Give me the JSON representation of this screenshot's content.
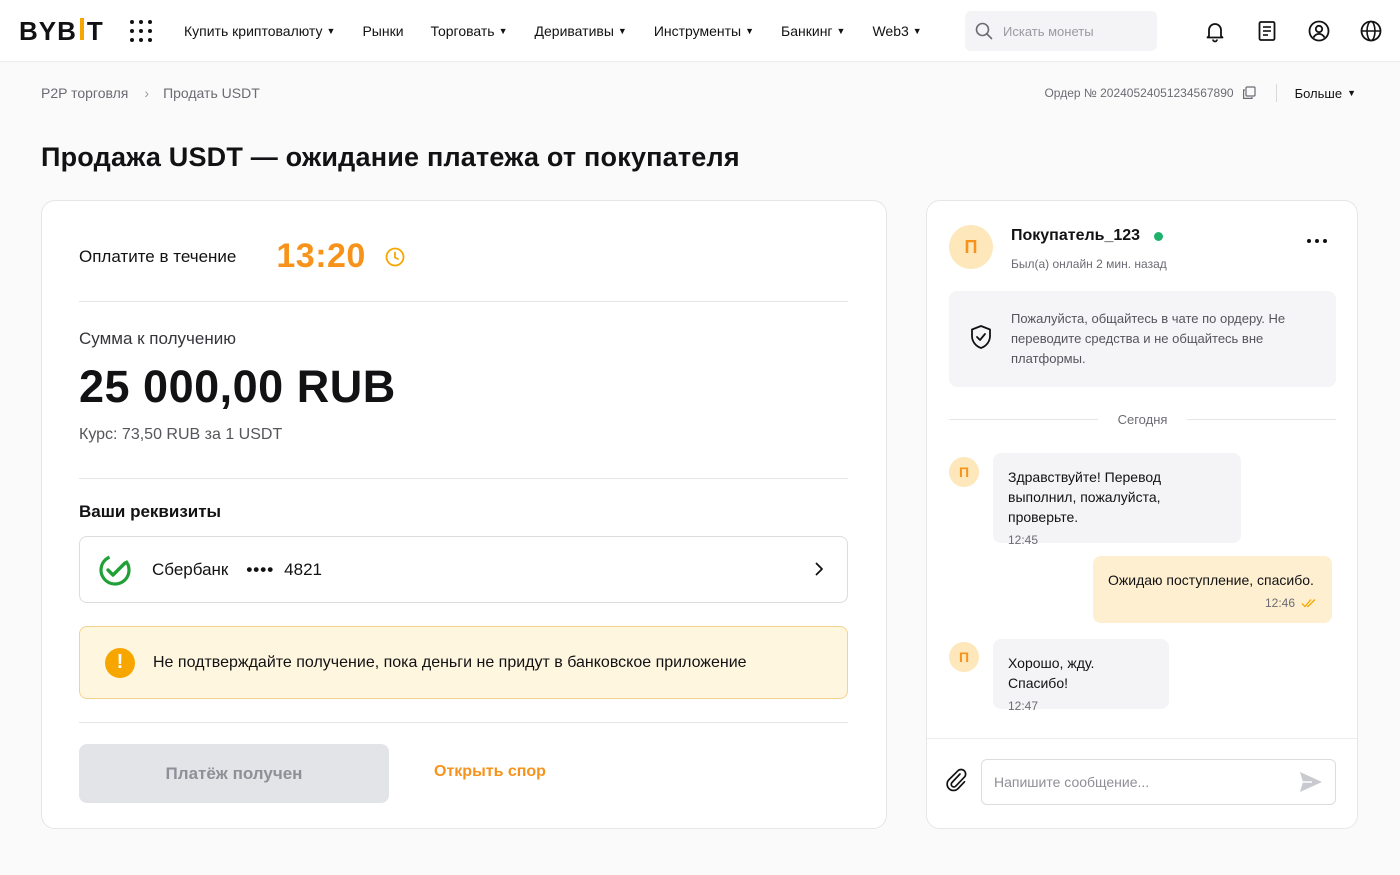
{
  "header": {
    "logo_text_left": "BYB",
    "logo_text_right": "T",
    "nav": [
      {
        "label": "Купить криптовалюту",
        "caret": true
      },
      {
        "label": "Рынки",
        "caret": false
      },
      {
        "label": "Торговать",
        "caret": true
      },
      {
        "label": "Деривативы",
        "caret": true
      },
      {
        "label": "Инструменты",
        "caret": true
      },
      {
        "label": "Банкинг",
        "caret": true
      },
      {
        "label": "Web3",
        "caret": true
      }
    ],
    "search_placeholder": "Искать монеты",
    "icons": [
      "bell-icon",
      "orders-icon",
      "user-icon",
      "globe-icon"
    ]
  },
  "breadcrumb": {
    "items": [
      "P2P торговля",
      "Продать USDT"
    ],
    "separator": "›"
  },
  "order": {
    "number_label": "Ордер № 20240524051234567890",
    "more_label": "Больше"
  },
  "page_title": "Продажа USDT — ожидание платежа от покупателя",
  "payment": {
    "timer_label": "Оплатите в течение",
    "timer_value": "13:20",
    "sum_label": "Сумма к получению",
    "sum_value": "25 000,00 RUB",
    "rate": "Курс: 73,50 RUB за 1 USDT",
    "requisites_label": "Ваши реквизиты",
    "bank_name": "Сбербанк",
    "card_mask": "••••",
    "card_last4": "4821",
    "warning": "Не подтверждайте получение, пока деньги не придут в банковское приложение",
    "confirm_button": "Платёж получен",
    "dispute_link": "Открыть спор"
  },
  "chat": {
    "peer_initial": "П",
    "peer_name": "Покупатель_123",
    "peer_status": "Был(а) онлайн 2 мин. назад",
    "safety_notice": "Пожалуйста, общайтесь в чате по ордеру. Не переводите средства и не общайтесь вне платформы.",
    "day_label": "Сегодня",
    "messages": [
      {
        "from": "peer",
        "initial": "П",
        "text": "Здравствуйте! Перевод выполнил, пожалуйста, проверьте.",
        "time": "12:45"
      },
      {
        "from": "me",
        "text": "Ожидаю поступление, спасибо.",
        "time": "12:46"
      },
      {
        "from": "peer",
        "initial": "П",
        "text": "Хорошо, жду. Спасибо!",
        "time": "12:47"
      }
    ],
    "input_placeholder": "Напишите сообщение..."
  },
  "colors": {
    "accent": "#f7931a",
    "brand_yellow": "#f7a600",
    "online": "#20b26c",
    "sber_green": "#21a038"
  }
}
